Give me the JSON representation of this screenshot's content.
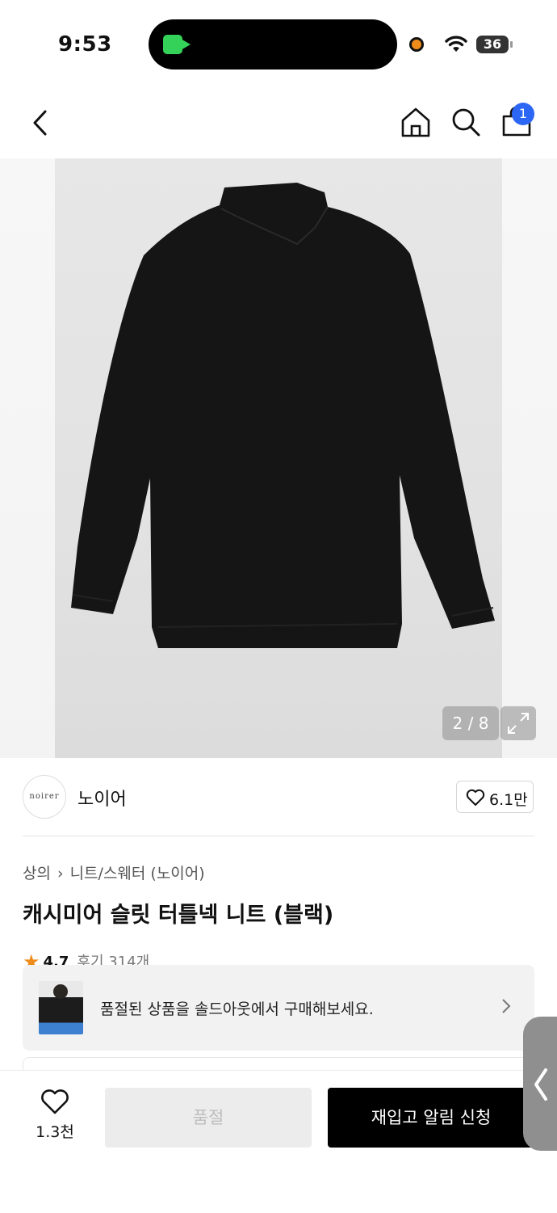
{
  "status_bar": {
    "time": "9:53",
    "battery": "36"
  },
  "nav": {
    "cart_count": "1"
  },
  "gallery": {
    "counter": "2 / 8"
  },
  "brand": {
    "logo_text": "noirer",
    "name": "노이어",
    "likes": "6.1만"
  },
  "breadcrumb": {
    "level1": "상의",
    "level2": "니트/스웨터 (노이어)"
  },
  "product": {
    "title": "캐시미어 슬릿 터틀넥 니트 (블랙)",
    "rating": "4.7",
    "reviews": "후기 314개"
  },
  "soldout_banner": {
    "text": "품절된 상품을 솔드아웃에서 구매해보세요."
  },
  "bottom_bar": {
    "wish_count": "1.3천",
    "soldout_label": "품절",
    "restock_label": "재입고 알림 신청"
  },
  "colors": {
    "accent_blue": "#2c66f4",
    "star": "#f08c1c",
    "facetime_green": "#35d25a"
  }
}
